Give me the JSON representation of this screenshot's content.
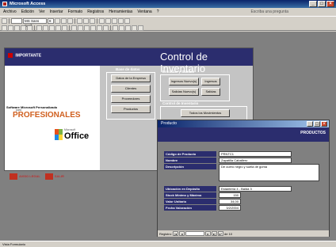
{
  "window": {
    "title": "Microsoft Access"
  },
  "menu": {
    "items": [
      "Archivo",
      "Edición",
      "Ver",
      "Insertar",
      "Formato",
      "Registros",
      "Herramientas",
      "Ventana",
      "?"
    ],
    "help_placeholder": "Escriba una pregunta"
  },
  "toolbar": {
    "font_name": "MS Sans Serif",
    "font_size": "8"
  },
  "switchboard": {
    "brand": "IMPORTANTE",
    "title": "Control de Inventario",
    "software_label": "Software Microsoft Personalizado",
    "para": "para",
    "profesionales": "PROFESIONALES",
    "microsoft": "Microsoft",
    "office": "Office",
    "aviso_legal": "AVISO LEGAL",
    "salir": "SALIR",
    "groups": {
      "datos": "Base de datos",
      "entradas": "Entradas y Salidas",
      "control": "Control de Inventario"
    },
    "buttons": {
      "datos_empresa": "Datos de la Empresa",
      "clientes": "Clientes",
      "proveedores": "Proveedores",
      "productos": "Productos",
      "ingresos_nuevo": "Ingresos Nuevo(s)",
      "ingresos": "Ingresos",
      "salidas_nuevo": "Salidas Nuevo(s)",
      "salidas": "Salidas",
      "todos_movimientos": "Todos los Movimientos"
    }
  },
  "productos_form": {
    "window_title": "Producto",
    "header": "PRODUCTOS",
    "fields": [
      {
        "label": "Código de Producto",
        "value": "PRNTC1"
      },
      {
        "label": "Nombre",
        "value": "Zapatilla Caballero"
      },
      {
        "label": "Descripción",
        "value": "De cuero negro y suela de goma"
      },
      {
        "label": "Ubicación en Depósito",
        "value": "Estantería 4 - Balda 3"
      },
      {
        "label": "Stock Mínimo y Máximo",
        "value": "150"
      },
      {
        "label": "Valor Unitario",
        "value": "34,00"
      },
      {
        "label": "Fecha Valoración",
        "value": "3/2/2004"
      }
    ],
    "navigator": {
      "label": "Registro:",
      "total": "de 10"
    }
  },
  "status": {
    "text": "Vista Formulario"
  }
}
